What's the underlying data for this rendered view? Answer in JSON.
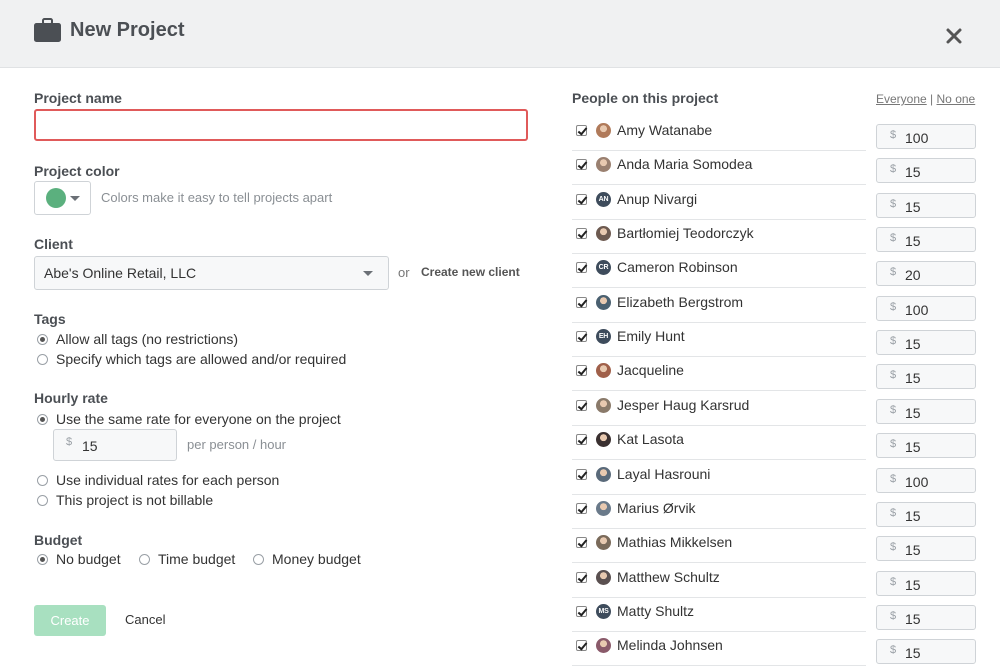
{
  "header": {
    "title": "New Project",
    "briefcase_icon": "briefcase-icon",
    "close_icon": "close-icon"
  },
  "form": {
    "project_name": {
      "label": "Project name",
      "value": ""
    },
    "project_color": {
      "label": "Project color",
      "color": "#5bb07e",
      "hint": "Colors make it easy to tell projects apart"
    },
    "client": {
      "label": "Client",
      "value": "Abe's Online Retail, LLC",
      "or_text": "or",
      "create_link": "Create new client"
    },
    "tags": {
      "label": "Tags",
      "options": [
        {
          "label": "Allow all tags (no restrictions)",
          "selected": true
        },
        {
          "label": "Specify which tags are allowed and/or required",
          "selected": false
        }
      ]
    },
    "hourly_rate": {
      "label": "Hourly rate",
      "options": [
        {
          "label": "Use the same rate for everyone on the project",
          "selected": true
        },
        {
          "label": "Use individual rates for each person",
          "selected": false
        },
        {
          "label": "This project is not billable",
          "selected": false
        }
      ],
      "currency": "$",
      "rate_value": "15",
      "rate_suffix": "per person / hour"
    },
    "budget": {
      "label": "Budget",
      "options": [
        {
          "label": "No budget",
          "selected": true
        },
        {
          "label": "Time budget",
          "selected": false
        },
        {
          "label": "Money budget",
          "selected": false
        }
      ]
    },
    "create_label": "Create",
    "cancel_label": "Cancel"
  },
  "people": {
    "title": "People on this project",
    "everyone_label": "Everyone",
    "separator": "|",
    "no_one_label": "No one",
    "currency": "$",
    "list": [
      {
        "name": "Amy Watanabe",
        "rate": "100",
        "checked": true,
        "initials": "",
        "avatar_color": "#b07a5a"
      },
      {
        "name": "Anda Maria Somodea",
        "rate": "15",
        "checked": true,
        "initials": "",
        "avatar_color": "#9a8070"
      },
      {
        "name": "Anup Nivargi",
        "rate": "15",
        "checked": true,
        "initials": "AN",
        "avatar_color": "#3e4c5c"
      },
      {
        "name": "Bartłomiej Teodorczyk",
        "rate": "15",
        "checked": true,
        "initials": "",
        "avatar_color": "#6d5a50"
      },
      {
        "name": "Cameron Robinson",
        "rate": "20",
        "checked": true,
        "initials": "CR",
        "avatar_color": "#3e4c5c"
      },
      {
        "name": "Elizabeth Bergstrom",
        "rate": "100",
        "checked": true,
        "initials": "",
        "avatar_color": "#4a6070"
      },
      {
        "name": "Emily Hunt",
        "rate": "15",
        "checked": true,
        "initials": "EH",
        "avatar_color": "#3e4c5c"
      },
      {
        "name": "Jacqueline",
        "rate": "15",
        "checked": true,
        "initials": "",
        "avatar_color": "#a0604a"
      },
      {
        "name": "Jesper Haug Karsrud",
        "rate": "15",
        "checked": true,
        "initials": "",
        "avatar_color": "#8a7a6a"
      },
      {
        "name": "Kat Lasota",
        "rate": "15",
        "checked": true,
        "initials": "",
        "avatar_color": "#3a3030"
      },
      {
        "name": "Layal Hasrouni",
        "rate": "100",
        "checked": true,
        "initials": "",
        "avatar_color": "#5a6a7a"
      },
      {
        "name": "Marius Ørvik",
        "rate": "15",
        "checked": true,
        "initials": "",
        "avatar_color": "#6a7a8a"
      },
      {
        "name": "Mathias Mikkelsen",
        "rate": "15",
        "checked": true,
        "initials": "",
        "avatar_color": "#7a6a5a"
      },
      {
        "name": "Matthew Schultz",
        "rate": "15",
        "checked": true,
        "initials": "",
        "avatar_color": "#5a5050"
      },
      {
        "name": "Matty Shultz",
        "rate": "15",
        "checked": true,
        "initials": "MS",
        "avatar_color": "#3e4c5c"
      },
      {
        "name": "Melinda Johnsen",
        "rate": "15",
        "checked": true,
        "initials": "",
        "avatar_color": "#8a5a6a"
      }
    ]
  },
  "colors": {
    "error_border": "#e05a5a",
    "create_button": "#a8e0c0",
    "header_bg": "#f0f1f2"
  }
}
